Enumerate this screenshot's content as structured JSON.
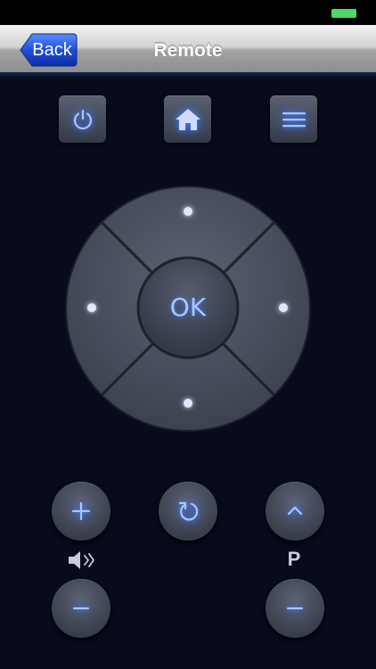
{
  "status_bar": {
    "battery_color": "#4cd964"
  },
  "nav": {
    "back_label": "Back",
    "title": "Remote"
  },
  "top_buttons": [
    {
      "name": "power",
      "icon": "power-icon"
    },
    {
      "name": "home",
      "icon": "home-icon"
    },
    {
      "name": "menu",
      "icon": "menu-icon"
    }
  ],
  "dpad": {
    "ok_label": "OK",
    "directions": [
      "up",
      "right",
      "down",
      "left"
    ]
  },
  "volume": {
    "icon": "speaker-icon",
    "up_icon": "plus-icon",
    "down_icon": "minus-icon"
  },
  "return": {
    "icon": "return-icon"
  },
  "program": {
    "label": "P",
    "up_icon": "chevron-up-icon",
    "down_icon": "minus-icon"
  },
  "colors": {
    "background": "#070b1b",
    "accent_glow": "#3b7cff",
    "button": "#3a3f4c"
  }
}
